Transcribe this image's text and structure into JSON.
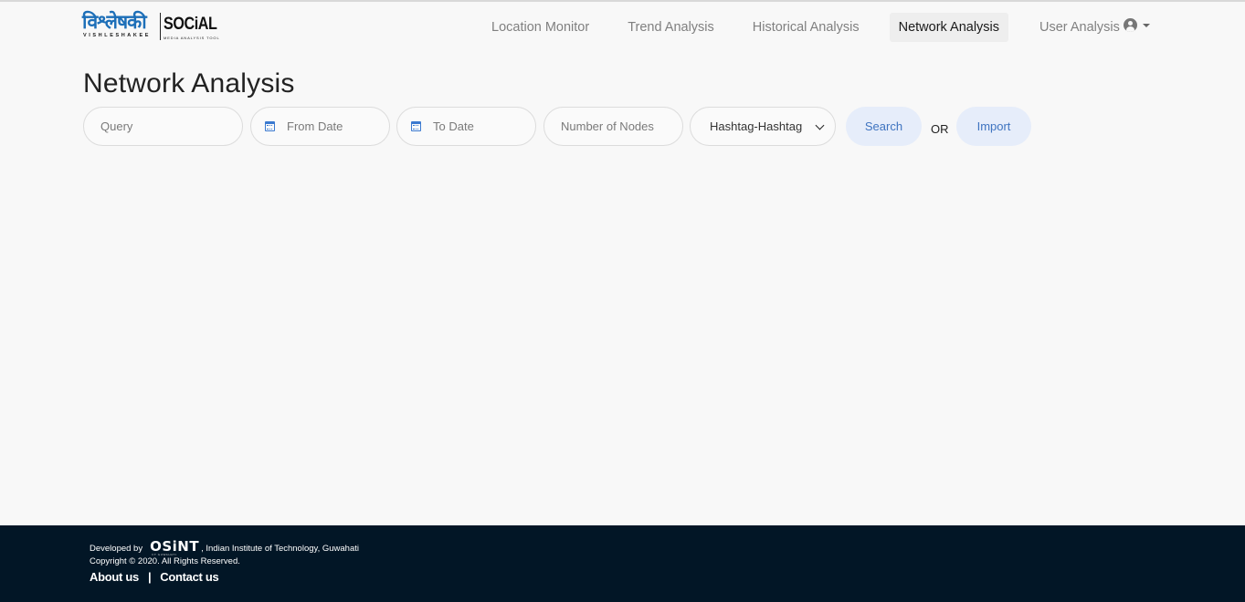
{
  "brand": {
    "hindi_text": "विश्लेषकी",
    "latin_text": "VISHLESHAKEE",
    "social_text": "SOCiAL",
    "tagline": "MEDIA ANALYSIS TOOL",
    "brand_color": "#1d6fb8"
  },
  "nav": {
    "items": [
      {
        "label": "Location Monitor",
        "active": false
      },
      {
        "label": "Trend Analysis",
        "active": false
      },
      {
        "label": "Historical Analysis",
        "active": false
      },
      {
        "label": "Network Analysis",
        "active": true
      },
      {
        "label": "User Analysis",
        "active": false
      }
    ],
    "user_icon": "user-circle-icon"
  },
  "main": {
    "title": "Network Analysis",
    "form": {
      "query_placeholder": "Query",
      "from_date_placeholder": "From Date",
      "to_date_placeholder": "To Date",
      "nodes_placeholder": "Number of Nodes",
      "network_type": "Hashtag-Hashtag",
      "search_label": "Search",
      "or_label": "OR",
      "import_label": "Import"
    },
    "accent_color": "#3f74c0"
  },
  "footer": {
    "developed_by": "Developed by",
    "org_logo_text": "OSiNT",
    "org_logo_sub": "IIT GUWAHATI",
    "institute": ", Indian Institute of Technology, Guwahati",
    "copyright": "Copyright © 2020.   All Rights Reserved.",
    "about_label": "About us",
    "separator": "|",
    "contact_label": "Contact us",
    "background": "#021626"
  }
}
